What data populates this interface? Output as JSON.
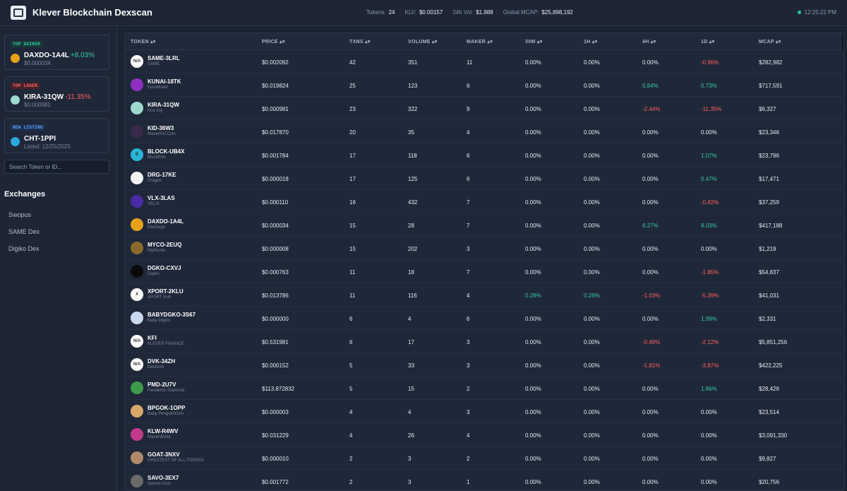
{
  "app": {
    "title": "Klever Blockchain Dexscan",
    "time": "12:25:22 PM",
    "stats": [
      {
        "label": "Tokens:",
        "value": "24"
      },
      {
        "label": "KLV:",
        "value": "$0.00157"
      },
      {
        "label": "24h Vol:",
        "value": "$1,988"
      },
      {
        "label": "Global MCAP:",
        "value": "$25,898,192"
      }
    ]
  },
  "sidebar": {
    "top_gainer": {
      "badge": "TOP GAINER",
      "name": "DAXDO-1A4L",
      "change": "+8.03%",
      "price": "$0.000034",
      "icon_color": "#e8a21a"
    },
    "top_loser": {
      "badge": "TOP LOSER",
      "name": "KIRA-31QW",
      "change": "-11.35%",
      "price": "$0.000981",
      "icon_color": "#9fd8cf"
    },
    "new_listing": {
      "badge": "NEW LISTING",
      "name": "CHT-1PPI",
      "listed": "Listed: 12/25/2025",
      "icon_color": "#2aa7e0"
    },
    "search_placeholder": "Search Token or ID...",
    "exchanges_title": "Exchanges",
    "exchanges": [
      "Swopus",
      "SAME Dex",
      "Digiko Dex"
    ]
  },
  "table": {
    "headers": [
      "TOKEN ▴▾",
      "PRICE ▴▾",
      "TXNS ▴▾",
      "VOLUME ▴▾",
      "MAKER ▴▾",
      "30M ▴▾",
      "1H ▴▾",
      "4H ▴▾",
      "1D ▴▾",
      "MCAP ▴▾"
    ],
    "rows": [
      {
        "symbol": "SAME-3LRL",
        "name": "SAME",
        "icon": "N/A",
        "icon_color": "#ffffff",
        "price": "$0.002092",
        "txns": "42",
        "volume": "351",
        "maker": "11",
        "m30": "0.00%",
        "h1": "0.00%",
        "h4": "0.00%",
        "d1": "-0.96%",
        "mcap": "$282,982"
      },
      {
        "symbol": "KUNAI-18TK",
        "name": "KunaiKash",
        "icon": "",
        "icon_color": "#8e2fbf",
        "price": "$0.019824",
        "txns": "25",
        "volume": "123",
        "maker": "6",
        "m30": "0.00%",
        "h1": "0.00%",
        "h4": "0.84%",
        "d1": "0.73%",
        "mcap": "$717,591"
      },
      {
        "symbol": "KIRA-31QW",
        "name": "Kira Joy",
        "icon": "",
        "icon_color": "#9fd8cf",
        "price": "$0.000981",
        "txns": "23",
        "volume": "322",
        "maker": "9",
        "m30": "0.00%",
        "h1": "0.00%",
        "h4": "-2.44%",
        "d1": "-11.35%",
        "mcap": "$6,327"
      },
      {
        "symbol": "KID-36W3",
        "name": "KleverKid Coin",
        "icon": "",
        "icon_color": "#3a2a4a",
        "price": "$0.017870",
        "txns": "20",
        "volume": "35",
        "maker": "4",
        "m30": "0.00%",
        "h1": "0.00%",
        "h4": "0.00%",
        "d1": "0.00%",
        "mcap": "$23,346"
      },
      {
        "symbol": "BLOCK-UB4X",
        "name": "BlockPort",
        "icon": "B",
        "icon_color": "#27b6d8",
        "price": "$0.001784",
        "txns": "17",
        "volume": "118",
        "maker": "6",
        "m30": "0.00%",
        "h1": "0.00%",
        "h4": "0.00%",
        "d1": "1.07%",
        "mcap": "$23,796"
      },
      {
        "symbol": "DRG-17KE",
        "name": "Dragon",
        "icon": "",
        "icon_color": "#f2f2f2",
        "price": "$0.000018",
        "txns": "17",
        "volume": "125",
        "maker": "6",
        "m30": "0.00%",
        "h1": "0.00%",
        "h4": "0.00%",
        "d1": "0.47%",
        "mcap": "$17,471"
      },
      {
        "symbol": "VLX-3LAS",
        "name": "VELIX",
        "icon": "",
        "icon_color": "#4b2aa6",
        "price": "$0.000110",
        "txns": "16",
        "volume": "432",
        "maker": "7",
        "m30": "0.00%",
        "h1": "0.00%",
        "h4": "0.00%",
        "d1": "-0.82%",
        "mcap": "$37,259"
      },
      {
        "symbol": "DAXDO-1A4L",
        "name": "DaxDoge",
        "icon": "",
        "icon_color": "#e8a21a",
        "price": "$0.000034",
        "txns": "15",
        "volume": "28",
        "maker": "7",
        "m30": "0.00%",
        "h1": "0.00%",
        "h4": "6.27%",
        "d1": "8.03%",
        "mcap": "$417,188"
      },
      {
        "symbol": "MYCO-2EUQ",
        "name": "Mythicoin",
        "icon": "",
        "icon_color": "#8a6a2a",
        "price": "$0.000008",
        "txns": "15",
        "volume": "202",
        "maker": "3",
        "m30": "0.00%",
        "h1": "0.00%",
        "h4": "0.00%",
        "d1": "0.00%",
        "mcap": "$1,219"
      },
      {
        "symbol": "DGKO-CXVJ",
        "name": "Digiko",
        "icon": "",
        "icon_color": "#0a0a0a",
        "price": "$0.000763",
        "txns": "11",
        "volume": "18",
        "maker": "7",
        "m30": "0.00%",
        "h1": "0.00%",
        "h4": "0.00%",
        "d1": "-1.85%",
        "mcap": "$54,837"
      },
      {
        "symbol": "XPORT-2KLU",
        "name": "XPORT Hub",
        "icon": "X",
        "icon_color": "#ffffff",
        "price": "$0.013786",
        "txns": "11",
        "volume": "116",
        "maker": "4",
        "m30": "0.28%",
        "h1": "0.28%",
        "h4": "-1.03%",
        "d1": "-5.39%",
        "mcap": "$41,031"
      },
      {
        "symbol": "BABYDGKO-3S67",
        "name": "Baby Digiko",
        "icon": "",
        "icon_color": "#c9d9ee",
        "price": "$0.000000",
        "txns": "6",
        "volume": "4",
        "maker": "6",
        "m30": "0.00%",
        "h1": "0.00%",
        "h4": "0.00%",
        "d1": "1.99%",
        "mcap": "$2,331"
      },
      {
        "symbol": "KFI",
        "name": "KLEVER FINANCE",
        "icon": "N/A",
        "icon_color": "#ffffff",
        "price": "$0.531981",
        "txns": "6",
        "volume": "17",
        "maker": "3",
        "m30": "0.00%",
        "h1": "0.00%",
        "h4": "-0.49%",
        "d1": "-2.12%",
        "mcap": "$5,851,256"
      },
      {
        "symbol": "DVK-34ZH",
        "name": "Devicoin",
        "icon": "N/A",
        "icon_color": "#ffffff",
        "price": "$0.000152",
        "txns": "5",
        "volume": "33",
        "maker": "3",
        "m30": "0.00%",
        "h1": "0.00%",
        "h4": "-1.81%",
        "d1": "-3.87%",
        "mcap": "$422,225"
      },
      {
        "symbol": "PMD-2U7V",
        "name": "Pandemic Diamond",
        "icon": "",
        "icon_color": "#3f9a4e",
        "price": "$113.872832",
        "txns": "5",
        "volume": "15",
        "maker": "2",
        "m30": "0.00%",
        "h1": "0.00%",
        "h4": "0.00%",
        "d1": "1.86%",
        "mcap": "$28,426"
      },
      {
        "symbol": "BPGOK-1OPP",
        "name": "Baby PengolinCoin",
        "icon": "",
        "icon_color": "#d9a86a",
        "price": "$0.000003",
        "txns": "4",
        "volume": "4",
        "maker": "3",
        "m30": "0.00%",
        "h1": "0.00%",
        "h4": "0.00%",
        "d1": "0.00%",
        "mcap": "$23,514"
      },
      {
        "symbol": "KLW-R4WV",
        "name": "KleverWorld",
        "icon": "",
        "icon_color": "#c23a8a",
        "price": "$0.031229",
        "txns": "4",
        "volume": "26",
        "maker": "4",
        "m30": "0.00%",
        "h1": "0.00%",
        "h4": "0.00%",
        "d1": "0.00%",
        "mcap": "$3,091,330"
      },
      {
        "symbol": "GOAT-3NXV",
        "name": "GREATEST OF ALL TOKENS",
        "icon": "",
        "icon_color": "#b08a6a",
        "price": "$0.000010",
        "txns": "2",
        "volume": "3",
        "maker": "2",
        "m30": "0.00%",
        "h1": "0.00%",
        "h4": "0.00%",
        "d1": "0.00%",
        "mcap": "$9,827"
      },
      {
        "symbol": "SAVO-3EX7",
        "name": "Savore Coin",
        "icon": "",
        "icon_color": "#6a6a6a",
        "price": "$0.001772",
        "txns": "2",
        "volume": "3",
        "maker": "1",
        "m30": "0.00%",
        "h1": "0.00%",
        "h4": "0.00%",
        "d1": "0.00%",
        "mcap": "$20,756"
      }
    ]
  },
  "colors": {
    "positive": "#36c9a2",
    "negative": "#ff5f5f",
    "live_dot": "#2ec49a"
  }
}
